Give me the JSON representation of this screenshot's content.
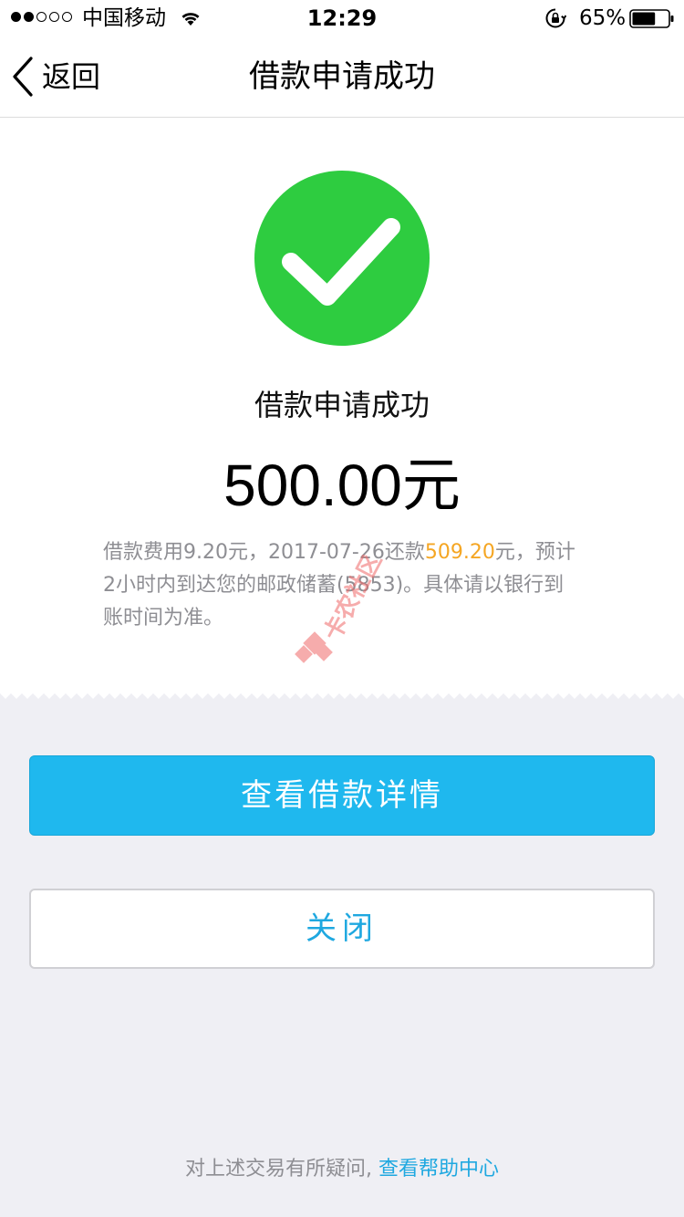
{
  "status_bar": {
    "carrier": "中国移动",
    "time": "12:29",
    "battery_percent": "65%",
    "battery_level": 0.65,
    "signal_dots": [
      "on",
      "on",
      "off",
      "off",
      "off"
    ]
  },
  "nav": {
    "back_label": "返回",
    "title": "借款申请成功"
  },
  "result": {
    "title": "借款申请成功",
    "amount": "500.00元",
    "info_part1": "借款费用9.20元，2017-07-26还款",
    "info_highlight": "509.20",
    "info_part2": "元，预计2小时内到达您的邮政储蓄(5853)。具体请以银行到账时间为准。"
  },
  "actions": {
    "primary_label": "查看借款详情",
    "secondary_label": "关闭"
  },
  "footer": {
    "text": "对上述交易有所疑问,",
    "link_label": "查看帮助中心"
  },
  "watermark": {
    "text": "卡农社区"
  },
  "colors": {
    "accent": "#1fb8ee",
    "success": "#2ecc40",
    "highlight": "#f5a623",
    "muted_text": "#8e8e93",
    "background": "#efeff4"
  },
  "icons": {
    "back": "chevron-left-icon",
    "success": "check-circle-icon",
    "wifi": "wifi-icon",
    "rotation_lock": "rotation-lock-icon",
    "battery": "battery-icon"
  }
}
